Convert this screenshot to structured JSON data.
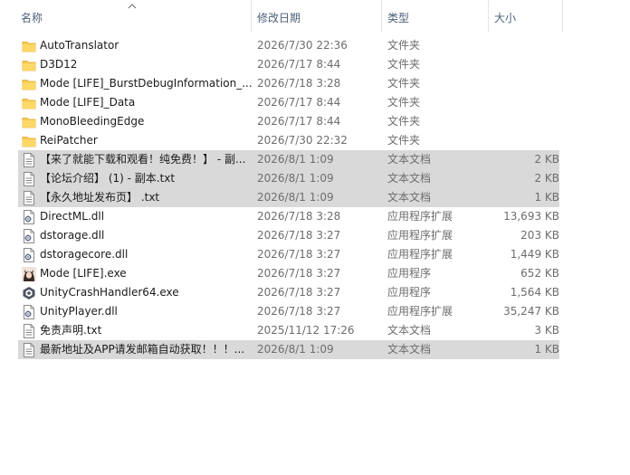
{
  "columns": {
    "name": "名称",
    "date": "修改日期",
    "type": "类型",
    "size": "大小"
  },
  "files": [
    {
      "name": "AutoTranslator",
      "date": "2026/7/30 22:36",
      "type": "文件夹",
      "size": "",
      "icon": "folder-icon",
      "selected": false
    },
    {
      "name": "D3D12",
      "date": "2026/7/17 8:44",
      "type": "文件夹",
      "size": "",
      "icon": "folder-icon",
      "selected": false
    },
    {
      "name": "Mode [LIFE]_BurstDebugInformation_...",
      "date": "2026/7/18 3:28",
      "type": "文件夹",
      "size": "",
      "icon": "folder-icon",
      "selected": false
    },
    {
      "name": "Mode [LIFE]_Data",
      "date": "2026/7/17 8:44",
      "type": "文件夹",
      "size": "",
      "icon": "folder-icon",
      "selected": false
    },
    {
      "name": "MonoBleedingEdge",
      "date": "2026/7/17 8:44",
      "type": "文件夹",
      "size": "",
      "icon": "folder-icon",
      "selected": false
    },
    {
      "name": "ReiPatcher",
      "date": "2026/7/30 22:32",
      "type": "文件夹",
      "size": "",
      "icon": "folder-icon",
      "selected": false
    },
    {
      "name": "【来了就能下载和观看！纯免费！】 - 副...",
      "date": "2026/8/1 1:09",
      "type": "文本文档",
      "size": "2 KB",
      "icon": "text-file-icon",
      "selected": true
    },
    {
      "name": "【论坛介绍】 (1) - 副本.txt",
      "date": "2026/8/1 1:09",
      "type": "文本文档",
      "size": "2 KB",
      "icon": "text-file-icon",
      "selected": true
    },
    {
      "name": "【永久地址发布页】 .txt",
      "date": "2026/8/1 1:09",
      "type": "文本文档",
      "size": "1 KB",
      "icon": "text-file-icon",
      "selected": true
    },
    {
      "name": "DirectML.dll",
      "date": "2026/7/18 3:28",
      "type": "应用程序扩展",
      "size": "13,693 KB",
      "icon": "dll-file-icon",
      "selected": false
    },
    {
      "name": "dstorage.dll",
      "date": "2026/7/18 3:27",
      "type": "应用程序扩展",
      "size": "203 KB",
      "icon": "dll-file-icon",
      "selected": false
    },
    {
      "name": "dstoragecore.dll",
      "date": "2026/7/18 3:27",
      "type": "应用程序扩展",
      "size": "1,449 KB",
      "icon": "dll-file-icon",
      "selected": false
    },
    {
      "name": "Mode [LIFE].exe",
      "date": "2026/7/18 3:27",
      "type": "应用程序",
      "size": "652 KB",
      "icon": "app-exe-icon",
      "selected": false
    },
    {
      "name": "UnityCrashHandler64.exe",
      "date": "2026/7/18 3:27",
      "type": "应用程序",
      "size": "1,564 KB",
      "icon": "unity-icon",
      "selected": false
    },
    {
      "name": "UnityPlayer.dll",
      "date": "2026/7/18 3:27",
      "type": "应用程序扩展",
      "size": "35,247 KB",
      "icon": "dll-file-icon",
      "selected": false
    },
    {
      "name": "免责声明.txt",
      "date": "2025/11/12 17:26",
      "type": "文本文档",
      "size": "3 KB",
      "icon": "text-file-icon",
      "selected": false
    },
    {
      "name": "最新地址及APP请发邮箱自动获取！！！...",
      "date": "2026/8/1 1:09",
      "type": "文本文档",
      "size": "1 KB",
      "icon": "text-file-icon",
      "selected": true
    }
  ]
}
